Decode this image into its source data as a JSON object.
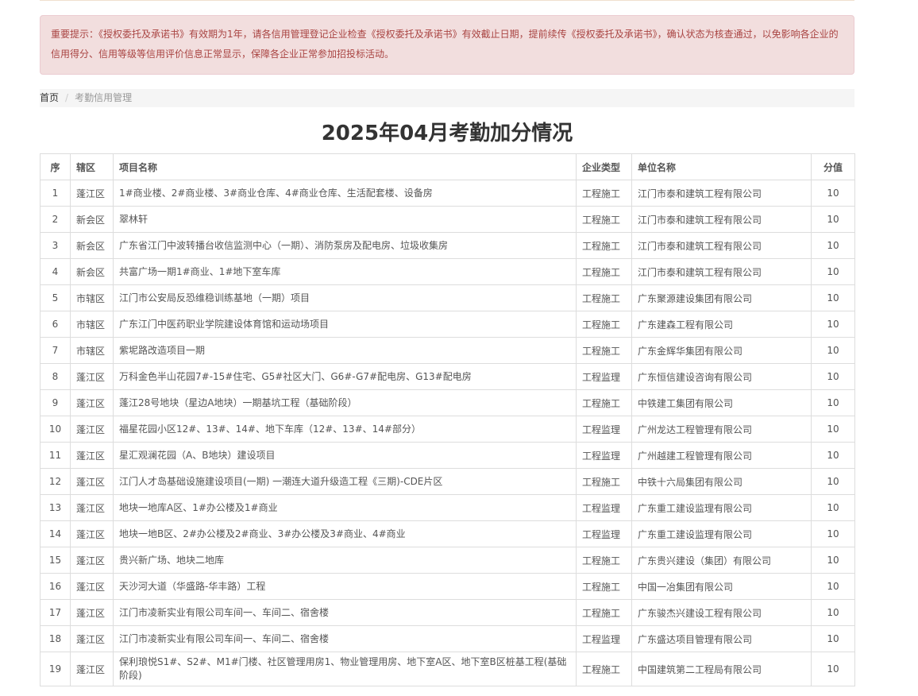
{
  "alert": {
    "text": "重要提示：《授权委托及承诺书》有效期为1年，请各信用管理登记企业检查《授权委托及承诺书》有效截止日期，提前续传《授权委托及承诺书》，确认状态为核查通过，以免影响各企业的信用得分、信用等级等信用评价信息正常显示，保障各企业正常参加招投标活动。"
  },
  "breadcrumb": {
    "home": "首页",
    "separator": "/",
    "current": "考勤信用管理"
  },
  "title": "2025年04月考勤加分情况",
  "table": {
    "headers": {
      "index": "序",
      "district": "辖区",
      "project": "项目名称",
      "type": "企业类型",
      "company": "单位名称",
      "score": "分值"
    },
    "rows": [
      {
        "index": "1",
        "district": "蓬江区",
        "project": "1#商业楼、2#商业楼、3#商业仓库、4#商业仓库、生活配套楼、设备房",
        "type": "工程施工",
        "company": "江门市泰和建筑工程有限公司",
        "score": "10"
      },
      {
        "index": "2",
        "district": "新会区",
        "project": "翠林轩",
        "type": "工程施工",
        "company": "江门市泰和建筑工程有限公司",
        "score": "10"
      },
      {
        "index": "3",
        "district": "新会区",
        "project": "广东省江门中波转播台收信监测中心（一期）、消防泵房及配电房、垃圾收集房",
        "type": "工程施工",
        "company": "江门市泰和建筑工程有限公司",
        "score": "10"
      },
      {
        "index": "4",
        "district": "新会区",
        "project": "共富广场一期1#商业、1#地下室车库",
        "type": "工程施工",
        "company": "江门市泰和建筑工程有限公司",
        "score": "10"
      },
      {
        "index": "5",
        "district": "市辖区",
        "project": "江门市公安局反恐维稳训练基地（一期）项目",
        "type": "工程施工",
        "company": "广东聚源建设集团有限公司",
        "score": "10"
      },
      {
        "index": "6",
        "district": "市辖区",
        "project": "广东江门中医药职业学院建设体育馆和运动场项目",
        "type": "工程施工",
        "company": "广东建森工程有限公司",
        "score": "10"
      },
      {
        "index": "7",
        "district": "市辖区",
        "project": "紫坭路改造项目一期",
        "type": "工程施工",
        "company": "广东金辉华集团有限公司",
        "score": "10"
      },
      {
        "index": "8",
        "district": "蓬江区",
        "project": "万科金色半山花园7#-15#住宅、G5#社区大门、G6#-G7#配电房、G13#配电房",
        "type": "工程监理",
        "company": "广东恒信建设咨询有限公司",
        "score": "10"
      },
      {
        "index": "9",
        "district": "蓬江区",
        "project": "蓬江28号地块（星边A地块）一期基坑工程（基础阶段）",
        "type": "工程施工",
        "company": "中铁建工集团有限公司",
        "score": "10"
      },
      {
        "index": "10",
        "district": "蓬江区",
        "project": "福星花园小区12#、13#、14#、地下车库（12#、13#、14#部分）",
        "type": "工程监理",
        "company": "广州龙达工程管理有限公司",
        "score": "10"
      },
      {
        "index": "11",
        "district": "蓬江区",
        "project": "星汇观澜花园（A、B地块）建设项目",
        "type": "工程监理",
        "company": "广州越建工程管理有限公司",
        "score": "10"
      },
      {
        "index": "12",
        "district": "蓬江区",
        "project": "江门人才岛基础设施建设项目(一期) 一潮连大道升级造工程《三期)-CDE片区",
        "type": "工程施工",
        "company": "中铁十六局集团有限公司",
        "score": "10"
      },
      {
        "index": "13",
        "district": "蓬江区",
        "project": "地块一地库A区、1#办公楼及1#商业",
        "type": "工程监理",
        "company": "广东重工建设监理有限公司",
        "score": "10"
      },
      {
        "index": "14",
        "district": "蓬江区",
        "project": "地块一地B区、2#办公楼及2#商业、3#办公楼及3#商业、4#商业",
        "type": "工程监理",
        "company": "广东重工建设监理有限公司",
        "score": "10"
      },
      {
        "index": "15",
        "district": "蓬江区",
        "project": "贵兴新广场、地块二地库",
        "type": "工程施工",
        "company": "广东贵兴建设（集团）有限公司",
        "score": "10"
      },
      {
        "index": "16",
        "district": "蓬江区",
        "project": "天沙河大道（华盛路-华丰路）工程",
        "type": "工程施工",
        "company": "中国一冶集团有限公司",
        "score": "10"
      },
      {
        "index": "17",
        "district": "蓬江区",
        "project": "江门市凌新实业有限公司车间一、车间二、宿舍楼",
        "type": "工程施工",
        "company": "广东骏杰兴建设工程有限公司",
        "score": "10"
      },
      {
        "index": "18",
        "district": "蓬江区",
        "project": "江门市凌新实业有限公司车间一、车间二、宿舍楼",
        "type": "工程监理",
        "company": "广东盛达项目管理有限公司",
        "score": "10"
      },
      {
        "index": "19",
        "district": "蓬江区",
        "project": "保利琅悦S1#、S2#、M1#门楼、社区管理用房1、物业管理用房、地下室A区、地下室B区桩基工程(基础阶段)",
        "type": "工程施工",
        "company": "中国建筑第二工程局有限公司",
        "score": "10"
      }
    ]
  },
  "colors": {
    "alert_bg": "#f2dede",
    "alert_text": "#a94442",
    "breadcrumb_bg": "#f5f5f5",
    "border": "#dddddd"
  }
}
